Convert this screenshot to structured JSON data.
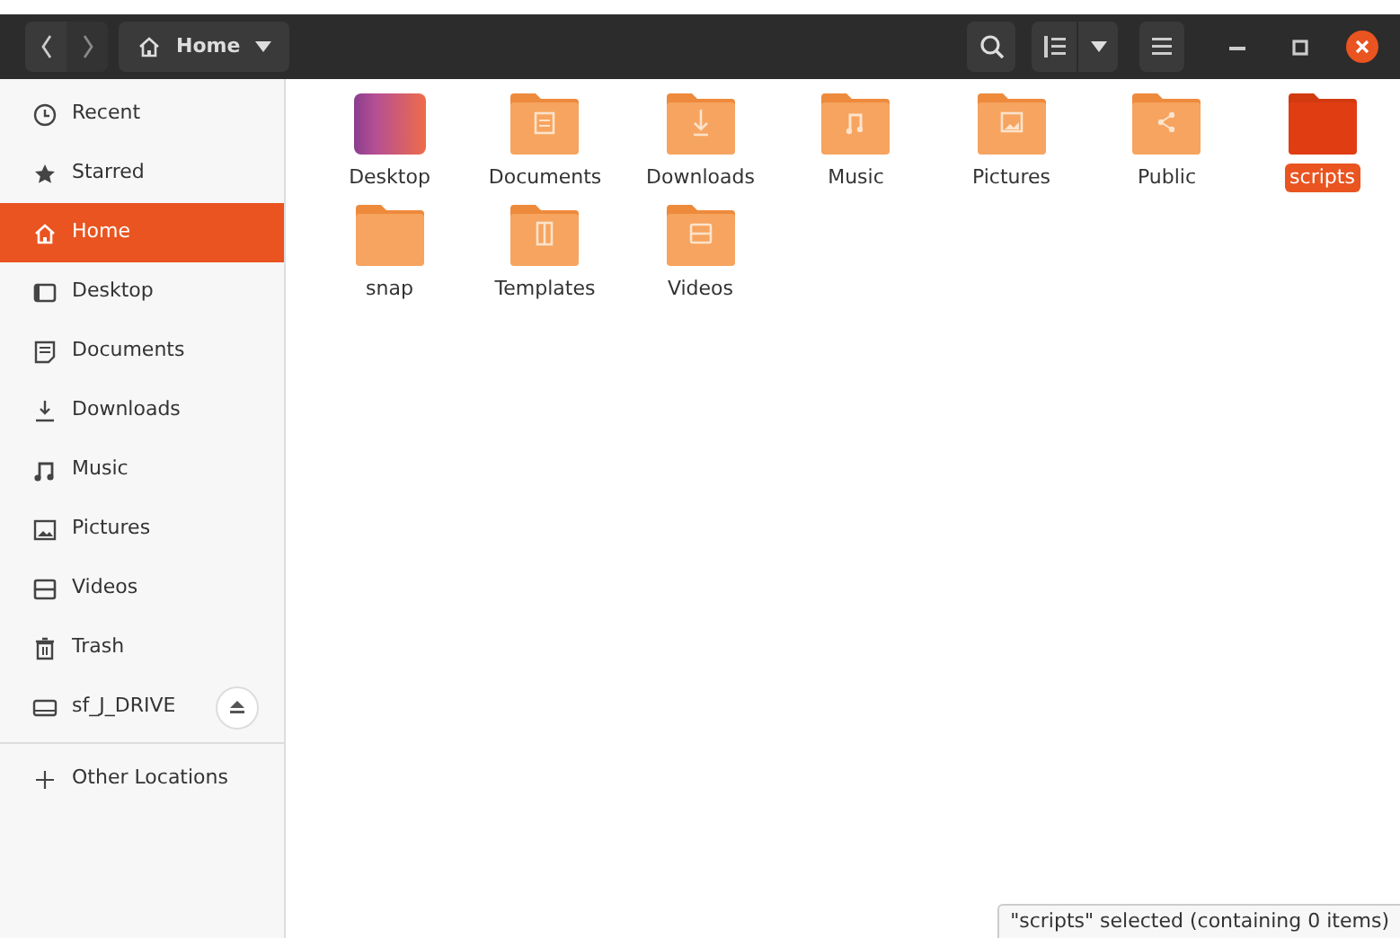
{
  "header": {
    "path": "Home"
  },
  "sidebar": {
    "items": [
      {
        "label": "Recent",
        "kind": "recent",
        "selected": false
      },
      {
        "label": "Starred",
        "kind": "starred",
        "selected": false
      },
      {
        "label": "Home",
        "kind": "home",
        "selected": true
      },
      {
        "label": "Desktop",
        "kind": "desktop",
        "selected": false
      },
      {
        "label": "Documents",
        "kind": "documents",
        "selected": false
      },
      {
        "label": "Downloads",
        "kind": "downloads",
        "selected": false
      },
      {
        "label": "Music",
        "kind": "music",
        "selected": false
      },
      {
        "label": "Pictures",
        "kind": "pictures",
        "selected": false
      },
      {
        "label": "Videos",
        "kind": "videos",
        "selected": false
      },
      {
        "label": "Trash",
        "kind": "trash",
        "selected": false
      },
      {
        "label": "sf_J_DRIVE",
        "kind": "drive",
        "selected": false
      },
      {
        "label": "Other Locations",
        "kind": "other",
        "selected": false
      }
    ]
  },
  "files": [
    {
      "name": "Desktop",
      "kind": "desktop",
      "selected": false
    },
    {
      "name": "Documents",
      "kind": "documents",
      "selected": false
    },
    {
      "name": "Downloads",
      "kind": "downloads",
      "selected": false
    },
    {
      "name": "Music",
      "kind": "music",
      "selected": false
    },
    {
      "name": "Pictures",
      "kind": "pictures",
      "selected": false
    },
    {
      "name": "Public",
      "kind": "public",
      "selected": false
    },
    {
      "name": "scripts",
      "kind": "plain",
      "selected": true
    },
    {
      "name": "snap",
      "kind": "plain",
      "selected": false
    },
    {
      "name": "Templates",
      "kind": "templates",
      "selected": false
    },
    {
      "name": "Videos",
      "kind": "videos",
      "selected": false
    }
  ],
  "status_bar": "\"scripts\" selected  (containing 0 items)"
}
